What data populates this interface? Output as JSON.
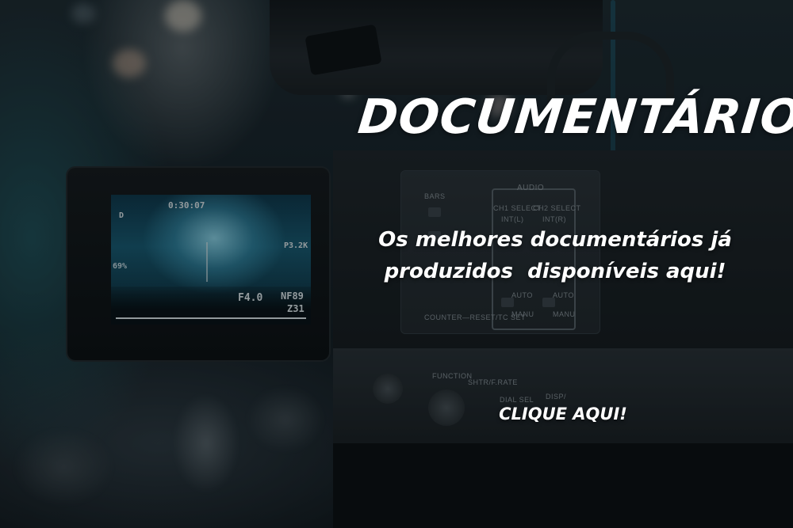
{
  "banner": {
    "headline": "DOCUMENTÁRIOS",
    "subtitle_line1": "Os melhores documentários já",
    "subtitle_line2": "produzidos  disponíveis aqui!",
    "cta_label": "CLIQUE AQUI!"
  },
  "camera": {
    "panel_labels": {
      "bars": "BARS",
      "audio": "AUDIO",
      "ch1_select": "CH1 SELECT",
      "ch2_select": "CH2 SELECT",
      "intl1": "INT(L)",
      "intl2": "INT(R)",
      "auto1": "AUTO",
      "auto2": "AUTO",
      "manu1": "MANU",
      "manu2": "MANU",
      "counter": "COUNTER—RESET/TC SET",
      "function": "FUNCTION",
      "shtr": "SHTR/F.RATE",
      "dial_sel": "DIAL SEL",
      "disp": "DISP/"
    },
    "viewfinder": {
      "timecode": "0:30:07",
      "f_stop": "F4.0",
      "nd": "NF89",
      "zoom": "Z31",
      "p3": "P3.2K",
      "percent": "69%",
      "letter_d": "D"
    }
  },
  "colors": {
    "text": "#ffffff",
    "viewfinder_accent": "#6fd3ee"
  }
}
